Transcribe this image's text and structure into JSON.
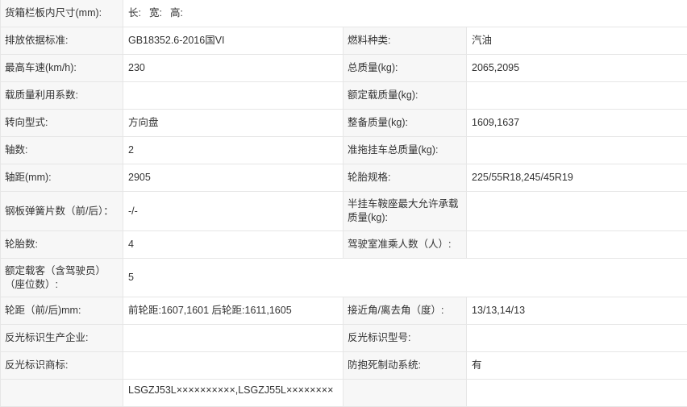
{
  "rows": [
    {
      "type": "dims",
      "h": 34,
      "label": "货箱栏板内尺寸(mm):",
      "dims": [
        "长:",
        "宽:",
        "高:"
      ]
    },
    {
      "type": "pair",
      "h": 34,
      "l1": "排放依据标准:",
      "v1": "GB18352.6-2016国VI",
      "l2": "燃料种类:",
      "v2": "汽油"
    },
    {
      "type": "pair",
      "h": 34,
      "l1": "最高车速(km/h):",
      "v1": "230",
      "l2": "总质量(kg):",
      "v2": "2065,2095"
    },
    {
      "type": "pair",
      "h": 34,
      "l1": "载质量利用系数:",
      "v1": "",
      "l2": "额定载质量(kg):",
      "v2": ""
    },
    {
      "type": "pair",
      "h": 34,
      "l1": "转向型式:",
      "v1": "方向盘",
      "l2": "整备质量(kg):",
      "v2": "1609,1637"
    },
    {
      "type": "pair",
      "h": 34,
      "l1": "轴数:",
      "v1": "2",
      "l2": "准拖挂车总质量(kg):",
      "v2": ""
    },
    {
      "type": "pair",
      "h": 34,
      "l1": "轴距(mm):",
      "v1": "2905",
      "l2": "轮胎规格:",
      "v2": "225/55R18,245/45R19"
    },
    {
      "type": "pair",
      "h": 49,
      "l1": "钢板弹簧片数（前/后）：",
      "v1": "-/-",
      "l2": "半挂车鞍座最大允许承载质量(kg):",
      "v2": ""
    },
    {
      "type": "pair",
      "h": 34,
      "l1": "轮胎数:",
      "v1": "4",
      "l2": "驾驶室准乘人数（人）:",
      "v2": ""
    },
    {
      "type": "single",
      "h": 48,
      "label": "额定载客（含驾驶员）（座位数）:",
      "value": "5"
    },
    {
      "type": "pair",
      "h": 34,
      "l1": "轮距（前/后)mm:",
      "v1": "前轮距:1607,1601 后轮距:1611,1605",
      "l2": "接近角/离去角（度）:",
      "v2": "13/13,14/13"
    },
    {
      "type": "pair",
      "h": 34,
      "l1": "反光标识生产企业:",
      "v1": "",
      "l2": "反光标识型号:",
      "v2": ""
    },
    {
      "type": "pair",
      "h": 34,
      "l1": "反光标识商标:",
      "v1": "",
      "l2": "防抱死制动系统:",
      "v2": "有"
    },
    {
      "type": "pair",
      "h": 34,
      "last": true,
      "l1": "",
      "v1": "LSGZJ53L××××××××××,LSGZJ55L××××××××",
      "l2": "",
      "v2": ""
    }
  ]
}
